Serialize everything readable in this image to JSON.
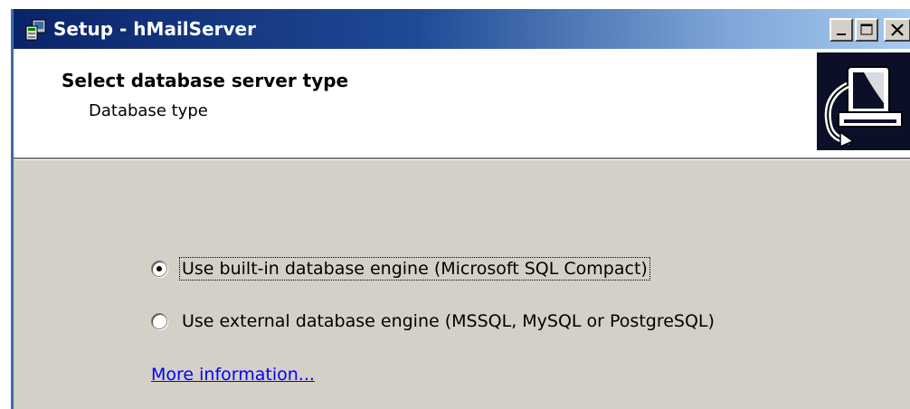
{
  "window": {
    "title": "Setup - hMailServer",
    "controls": {
      "minimize": "minimize-icon",
      "maximize": "maximize-icon",
      "close": "close-icon"
    }
  },
  "header": {
    "title": "Select database server type",
    "subtitle": "Database type",
    "image_icon": "computer-install-icon"
  },
  "options": [
    {
      "label": "Use built-in database engine (Microsoft SQL Compact)",
      "checked": true
    },
    {
      "label": "Use external database engine (MSSQL, MySQL or PostgreSQL)",
      "checked": false
    }
  ],
  "more_info_link": "More information...",
  "colors": {
    "titlebar_start": "#0a246a",
    "titlebar_end": "#a6caf0",
    "dialog_background": "#d4d0c8",
    "link": "#0000ff"
  }
}
